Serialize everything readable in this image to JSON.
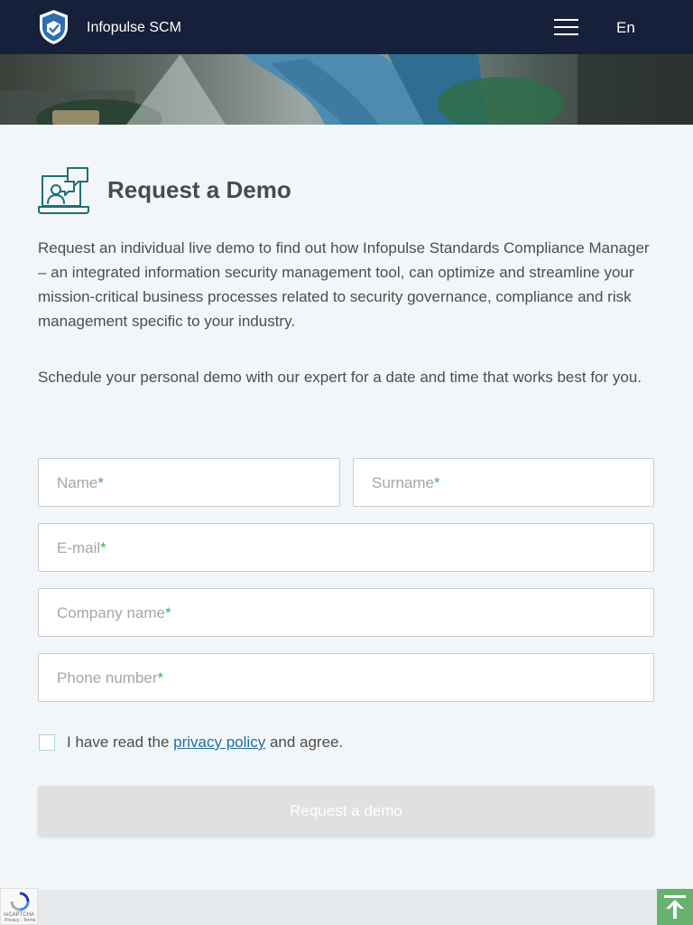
{
  "header": {
    "brand": "Infopulse SCM",
    "language": "En",
    "logo_icon": "shield-logo-icon",
    "menu_icon": "hamburger-menu-icon"
  },
  "section": {
    "icon": "demo-presentation-icon",
    "title": "Request a Demo",
    "intro": "Request an individual live demo to find out how Infopulse Standards Compliance Manager – an integrated information security management tool, can optimize and streamline your mission-critical business processes related to security governance, compliance and risk management specific to your industry.",
    "schedule": "Schedule your personal demo with our expert for a date and time that works best for you."
  },
  "form": {
    "name_placeholder": "Name",
    "surname_placeholder": "Surname",
    "email_placeholder": "E-mail",
    "company_placeholder": "Company name",
    "phone_placeholder": "Phone number",
    "required_mark": "*",
    "consent_prefix": "I have read the",
    "consent_link": "privacy policy",
    "consent_suffix": "and agree.",
    "submit_label": "Request a demo"
  },
  "recaptcha": {
    "label": "reCAPTCHA",
    "links": "Privacy - Terms"
  },
  "colors": {
    "header_bg": "#17203a",
    "accent_green": "#67b26e",
    "required_green": "#4caf50",
    "link_blue": "#1c6fa3",
    "icon_teal": "#1f6f73"
  }
}
